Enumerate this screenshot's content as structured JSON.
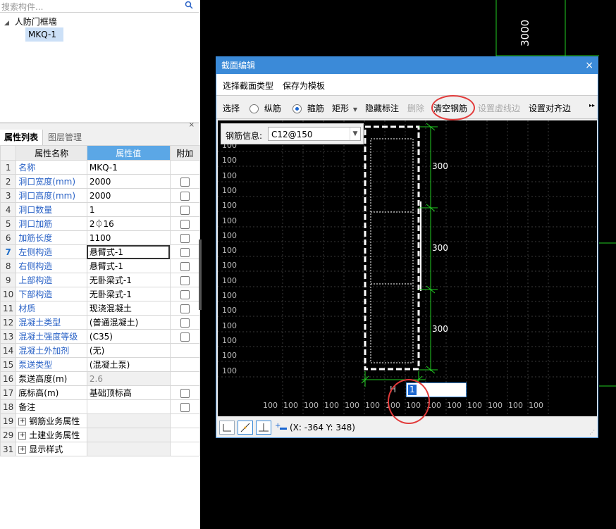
{
  "search": {
    "placeholder": "搜索构件..."
  },
  "tree": {
    "root_label": "人防门框墙",
    "child_label": "MKQ-1"
  },
  "props_panel": {
    "tabs": [
      "属性列表",
      "图层管理"
    ],
    "headers": {
      "no": "",
      "name": "属性名称",
      "value": "属性值",
      "extra": "附加"
    },
    "rows": [
      {
        "no": "1",
        "name": "名称",
        "value": "MKQ-1",
        "blue": true,
        "checkbox": false
      },
      {
        "no": "2",
        "name": "洞口宽度(mm)",
        "value": "2000",
        "blue": true,
        "checkbox": true
      },
      {
        "no": "3",
        "name": "洞口高度(mm)",
        "value": "2000",
        "blue": true,
        "checkbox": true
      },
      {
        "no": "4",
        "name": "洞口数量",
        "value": "1",
        "blue": true,
        "checkbox": true
      },
      {
        "no": "5",
        "name": "洞口加筋",
        "value": "2⏀16",
        "blue": true,
        "checkbox": true
      },
      {
        "no": "6",
        "name": "加筋长度",
        "value": "1100",
        "blue": true,
        "checkbox": true
      },
      {
        "no": "7",
        "name": "左侧构造",
        "value": "悬臂式-1",
        "blue": true,
        "checkbox": true,
        "selected": true
      },
      {
        "no": "8",
        "name": "右侧构造",
        "value": "悬臂式-1",
        "blue": true,
        "checkbox": true
      },
      {
        "no": "9",
        "name": "上部构造",
        "value": "无卧梁式-1",
        "blue": true,
        "checkbox": true
      },
      {
        "no": "10",
        "name": "下部构造",
        "value": "无卧梁式-1",
        "blue": true,
        "checkbox": true
      },
      {
        "no": "11",
        "name": "材质",
        "value": "现浇混凝土",
        "blue": true,
        "checkbox": true
      },
      {
        "no": "12",
        "name": "混凝土类型",
        "value": "(普通混凝土)",
        "blue": true,
        "checkbox": true
      },
      {
        "no": "13",
        "name": "混凝土强度等级",
        "value": "(C35)",
        "blue": true,
        "checkbox": true
      },
      {
        "no": "14",
        "name": "混凝土外加剂",
        "value": "(无)",
        "blue": true,
        "checkbox": false
      },
      {
        "no": "15",
        "name": "泵送类型",
        "value": "(混凝土泵)",
        "blue": true,
        "checkbox": false
      },
      {
        "no": "16",
        "name": "泵送高度(m)",
        "value": "2.6",
        "blue": false,
        "checkbox": false,
        "gray": true
      },
      {
        "no": "17",
        "name": "底标高(m)",
        "value": "基础顶标高",
        "blue": false,
        "checkbox": true
      },
      {
        "no": "18",
        "name": "备注",
        "value": "",
        "blue": false,
        "checkbox": true
      },
      {
        "no": "19",
        "name": "钢筋业务属性",
        "value": "",
        "blue": false,
        "checkbox": false,
        "expand": true
      },
      {
        "no": "29",
        "name": "土建业务属性",
        "value": "",
        "blue": false,
        "checkbox": false,
        "expand": true
      },
      {
        "no": "31",
        "name": "显示样式",
        "value": "",
        "blue": false,
        "checkbox": false,
        "expand": true
      }
    ]
  },
  "background": {
    "dimension_label": "3000"
  },
  "dialog": {
    "title": "截面编辑",
    "close": "×",
    "menu": {
      "select_type": "选择截面类型",
      "save_template": "保存为模板"
    },
    "toolbar": {
      "select": "选择",
      "longitudinal": "纵筋",
      "stirrup": "箍筋",
      "shape": "矩形",
      "hide_annotation": "隐藏标注",
      "delete": "删除",
      "clear_rebar": "清空钢筋",
      "set_virtual_line": "设置虚线边",
      "set_align_edge": "设置对齐边",
      "more": "▸▸"
    },
    "rebar_info": {
      "label": "钢筋信息:",
      "value": "C12@150"
    },
    "grid_label": "100",
    "dims": [
      "300",
      "300",
      "300"
    ],
    "cursor_label": "H",
    "input_value": "1",
    "coordinates": "(X: -364 Y: 348)",
    "colors": {
      "title_bar": "#3b8ad8",
      "dim_line": "#22cc22",
      "highlight_circle": "#e23a3a"
    }
  }
}
